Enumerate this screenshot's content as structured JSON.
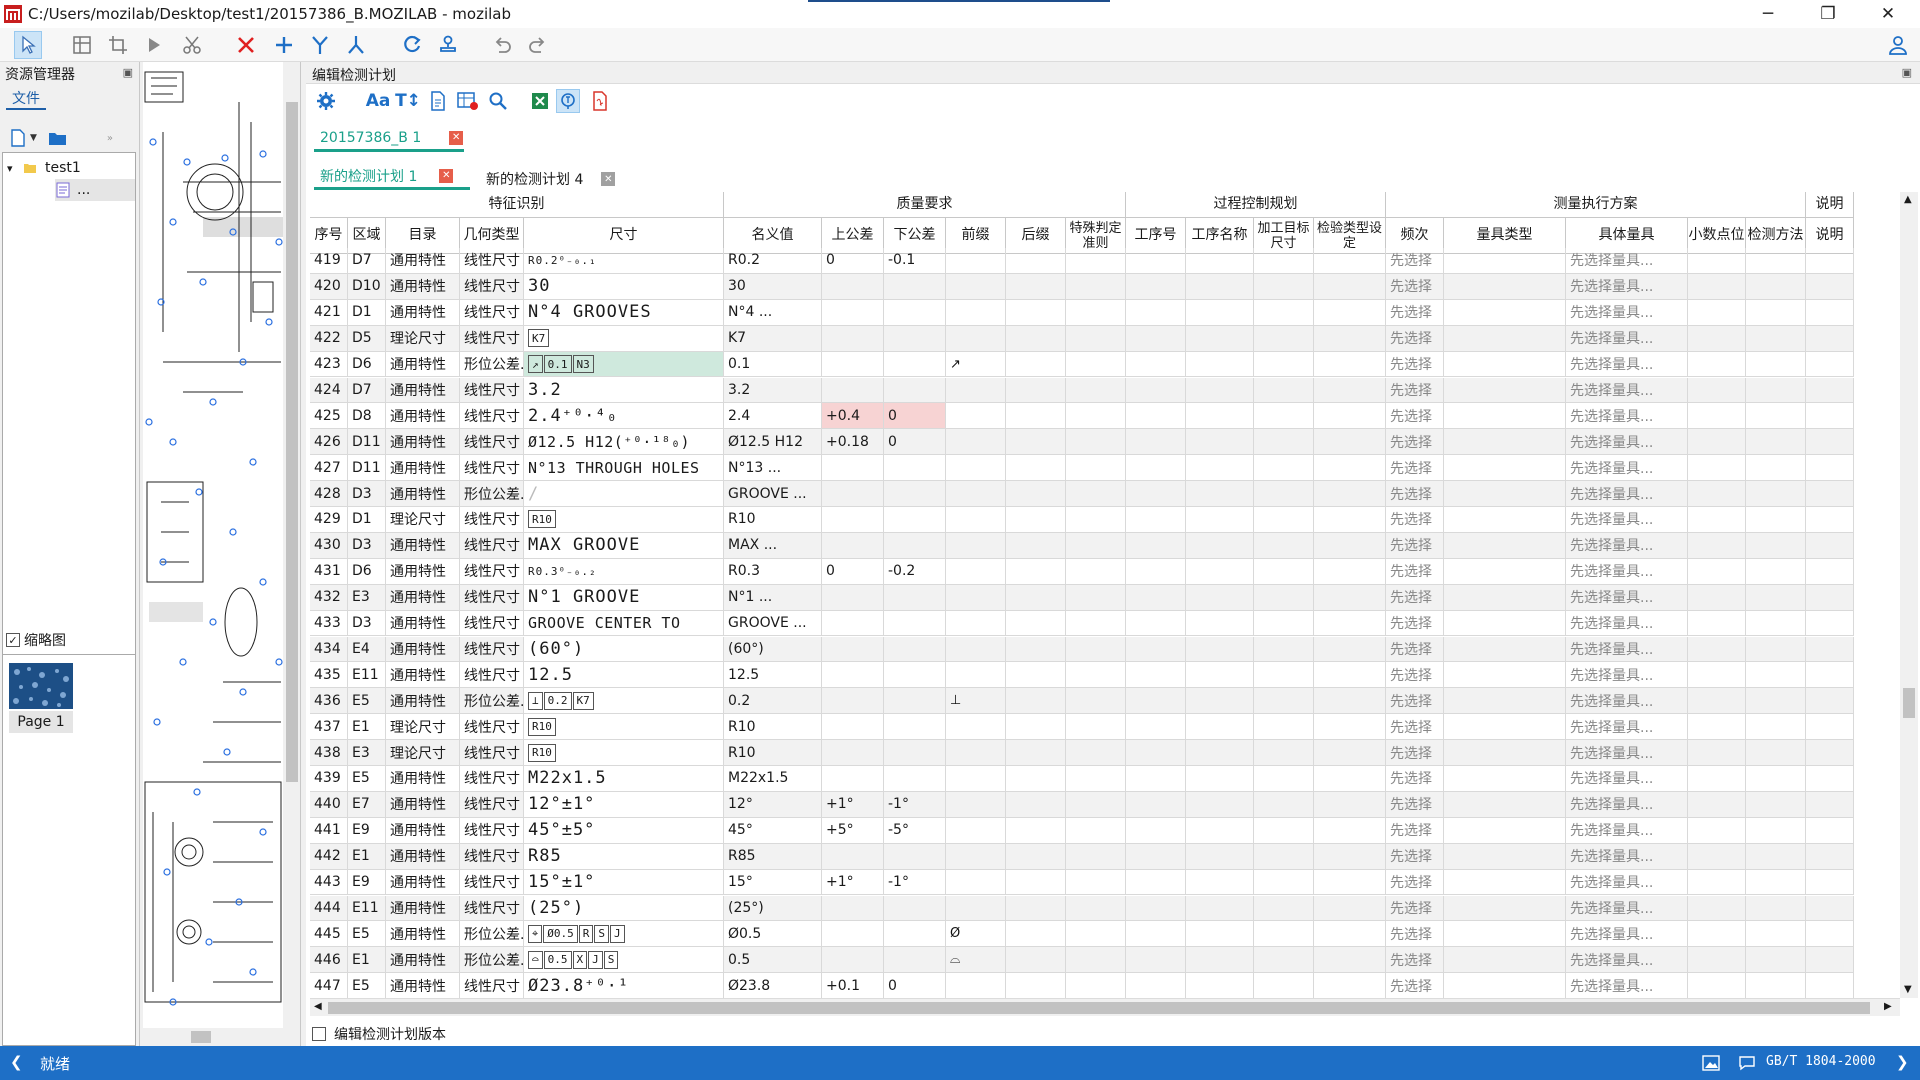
{
  "window": {
    "title": "C:/Users/mozilab/Desktop/test1/20157386_B.MOZILAB - mozilab",
    "controls": {
      "minimize": "─",
      "maximize": "❐",
      "close": "✕"
    }
  },
  "resource_panel": {
    "title": "资源管理器",
    "tab_label": "文件",
    "tree": {
      "root": "test1",
      "child": "..."
    },
    "thumbnail": {
      "title": "缩略图",
      "checked": true,
      "page_label": "Page 1"
    }
  },
  "editor": {
    "title": "编辑检测计划",
    "doc_tab": "20157386_B 1",
    "plan_tabs": [
      "新的检测计划 1",
      "新的检测计划 4"
    ],
    "footer_checkbox_label": "编辑检测计划版本"
  },
  "table": {
    "groups": [
      {
        "label": "特征识别"
      },
      {
        "label": "质量要求"
      },
      {
        "label": "过程控制规划"
      },
      {
        "label": "测量执行方案"
      },
      {
        "label": "说明"
      }
    ],
    "columns": [
      "序号",
      "区域",
      "目录",
      "几何类型",
      "尺寸",
      "名义值",
      "上公差",
      "下公差",
      "前缀",
      "后缀",
      "特殊判定准则",
      "工序号",
      "工序名称",
      "加工目标尺寸",
      "检验类型设定",
      "频次",
      "量具类型",
      "具体量具",
      "小数点位",
      "检测方法",
      "说明"
    ],
    "placeholder_freq": "先选择",
    "placeholder_gauge": "先选择量具...",
    "rows": [
      {
        "id": "419",
        "zone": "D7",
        "cat": "通用特性",
        "geo": "线性尺寸",
        "dim": "R0.2⁰₋₀.₁",
        "dim_style": "small",
        "nom": "R0.2",
        "up": "0",
        "low": "-0.1",
        "pre": ""
      },
      {
        "id": "420",
        "zone": "D10",
        "cat": "通用特性",
        "geo": "线性尺寸",
        "dim": "30",
        "dim_style": "big",
        "nom": "30",
        "up": "",
        "low": "",
        "pre": ""
      },
      {
        "id": "421",
        "zone": "D1",
        "cat": "通用特性",
        "geo": "线性尺寸",
        "dim": "N°4 GROOVES",
        "dim_style": "big",
        "nom": "N°4 ...",
        "up": "",
        "low": "",
        "pre": ""
      },
      {
        "id": "422",
        "zone": "D5",
        "cat": "理论尺寸",
        "geo": "线性尺寸",
        "dim": "K7",
        "dim_style": "box",
        "nom": "K7",
        "up": "",
        "low": "",
        "pre": ""
      },
      {
        "id": "423",
        "zone": "D6",
        "cat": "通用特性",
        "geo": "形位公差...",
        "dim": "↗|0.1|N3",
        "dim_style": "fcf",
        "nom": "0.1",
        "up": "",
        "low": "",
        "pre": "↗",
        "hl": "green"
      },
      {
        "id": "424",
        "zone": "D7",
        "cat": "通用特性",
        "geo": "线性尺寸",
        "dim": "3.2",
        "dim_style": "big",
        "nom": "3.2",
        "up": "",
        "low": "",
        "pre": ""
      },
      {
        "id": "425",
        "zone": "D8",
        "cat": "通用特性",
        "geo": "线性尺寸",
        "dim": "2.4⁺⁰·⁴₀",
        "dim_style": "big",
        "nom": "2.4",
        "up": "+0.4",
        "low": "0",
        "pre": "",
        "hl": "red"
      },
      {
        "id": "426",
        "zone": "D11",
        "cat": "通用特性",
        "geo": "线性尺寸",
        "dim": "Ø12.5 H12(⁺⁰·¹⁸₀)",
        "dim_style": "big",
        "nom": "Ø12.5 H12",
        "up": "+0.18",
        "low": "0",
        "pre": ""
      },
      {
        "id": "427",
        "zone": "D11",
        "cat": "通用特性",
        "geo": "线性尺寸",
        "dim": "N°13 THROUGH HOLES",
        "dim_style": "big",
        "nom": "N°13 ...",
        "up": "",
        "low": "",
        "pre": ""
      },
      {
        "id": "428",
        "zone": "D3",
        "cat": "通用特性",
        "geo": "形位公差...",
        "dim": "/",
        "dim_style": "faint",
        "nom": "GROOVE ...",
        "up": "",
        "low": "",
        "pre": ""
      },
      {
        "id": "429",
        "zone": "D1",
        "cat": "理论尺寸",
        "geo": "线性尺寸",
        "dim": "R10",
        "dim_style": "box",
        "nom": "R10",
        "up": "",
        "low": "",
        "pre": ""
      },
      {
        "id": "430",
        "zone": "D3",
        "cat": "通用特性",
        "geo": "线性尺寸",
        "dim": "MAX GROOVE",
        "dim_style": "big",
        "nom": "MAX ...",
        "up": "",
        "low": "",
        "pre": ""
      },
      {
        "id": "431",
        "zone": "D6",
        "cat": "通用特性",
        "geo": "线性尺寸",
        "dim": "R0.3⁰₋₀.₂",
        "dim_style": "small",
        "nom": "R0.3",
        "up": "0",
        "low": "-0.2",
        "pre": ""
      },
      {
        "id": "432",
        "zone": "E3",
        "cat": "通用特性",
        "geo": "线性尺寸",
        "dim": "N°1 GROOVE",
        "dim_style": "big",
        "nom": "N°1 ...",
        "up": "",
        "low": "",
        "pre": ""
      },
      {
        "id": "433",
        "zone": "D3",
        "cat": "通用特性",
        "geo": "线性尺寸",
        "dim": "GROOVE CENTER TO",
        "dim_style": "big",
        "nom": "GROOVE ...",
        "up": "",
        "low": "",
        "pre": ""
      },
      {
        "id": "434",
        "zone": "E4",
        "cat": "通用特性",
        "geo": "线性尺寸",
        "dim": "(60°)",
        "dim_style": "big",
        "nom": "(60°)",
        "up": "",
        "low": "",
        "pre": ""
      },
      {
        "id": "435",
        "zone": "E11",
        "cat": "通用特性",
        "geo": "线性尺寸",
        "dim": "12.5",
        "dim_style": "big",
        "nom": "12.5",
        "up": "",
        "low": "",
        "pre": ""
      },
      {
        "id": "436",
        "zone": "E5",
        "cat": "通用特性",
        "geo": "形位公差...",
        "dim": "⊥|0.2|K7",
        "dim_style": "fcf",
        "nom": "0.2",
        "up": "",
        "low": "",
        "pre": "⊥"
      },
      {
        "id": "437",
        "zone": "E1",
        "cat": "理论尺寸",
        "geo": "线性尺寸",
        "dim": "R10",
        "dim_style": "box",
        "nom": "R10",
        "up": "",
        "low": "",
        "pre": ""
      },
      {
        "id": "438",
        "zone": "E3",
        "cat": "理论尺寸",
        "geo": "线性尺寸",
        "dim": "R10",
        "dim_style": "box",
        "nom": "R10",
        "up": "",
        "low": "",
        "pre": ""
      },
      {
        "id": "439",
        "zone": "E5",
        "cat": "通用特性",
        "geo": "线性尺寸",
        "dim": "M22x1.5",
        "dim_style": "big",
        "nom": "M22x1.5",
        "up": "",
        "low": "",
        "pre": ""
      },
      {
        "id": "440",
        "zone": "E7",
        "cat": "通用特性",
        "geo": "线性尺寸",
        "dim": "12°±1°",
        "dim_style": "big",
        "nom": "12°",
        "up": "+1°",
        "low": "-1°",
        "pre": ""
      },
      {
        "id": "441",
        "zone": "E9",
        "cat": "通用特性",
        "geo": "线性尺寸",
        "dim": "45°±5°",
        "dim_style": "big",
        "nom": "45°",
        "up": "+5°",
        "low": "-5°",
        "pre": ""
      },
      {
        "id": "442",
        "zone": "E1",
        "cat": "通用特性",
        "geo": "线性尺寸",
        "dim": "R85",
        "dim_style": "big",
        "nom": "R85",
        "up": "",
        "low": "",
        "pre": ""
      },
      {
        "id": "443",
        "zone": "E9",
        "cat": "通用特性",
        "geo": "线性尺寸",
        "dim": "15°±1°",
        "dim_style": "big",
        "nom": "15°",
        "up": "+1°",
        "low": "-1°",
        "pre": ""
      },
      {
        "id": "444",
        "zone": "E11",
        "cat": "通用特性",
        "geo": "线性尺寸",
        "dim": "(25°)",
        "dim_style": "big",
        "nom": "(25°)",
        "up": "",
        "low": "",
        "pre": ""
      },
      {
        "id": "445",
        "zone": "E5",
        "cat": "通用特性",
        "geo": "形位公差...",
        "dim": "⌖|Ø0.5|R|S|J",
        "dim_style": "fcf",
        "nom": "Ø0.5",
        "up": "",
        "low": "",
        "pre": "Ø"
      },
      {
        "id": "446",
        "zone": "E1",
        "cat": "通用特性",
        "geo": "形位公差...",
        "dim": "⌓|0.5|X|J|S",
        "dim_style": "fcf",
        "nom": "0.5",
        "up": "",
        "low": "",
        "pre": "⌓"
      },
      {
        "id": "447",
        "zone": "E5",
        "cat": "通用特性",
        "geo": "线性尺寸",
        "dim": "Ø23.8⁺⁰·¹",
        "dim_style": "big",
        "nom": "Ø23.8",
        "up": "+0.1",
        "low": "0",
        "pre": ""
      }
    ]
  },
  "statusbar": {
    "text": "就绪",
    "standard": "GB/T 1804-2000"
  },
  "colors": {
    "accent": "#1aa08a",
    "status_bar": "#1e6fc6",
    "title_accent": "#1e4e8c",
    "highlight_green": "#cfe9dd",
    "highlight_red": "#f7d3d3"
  }
}
